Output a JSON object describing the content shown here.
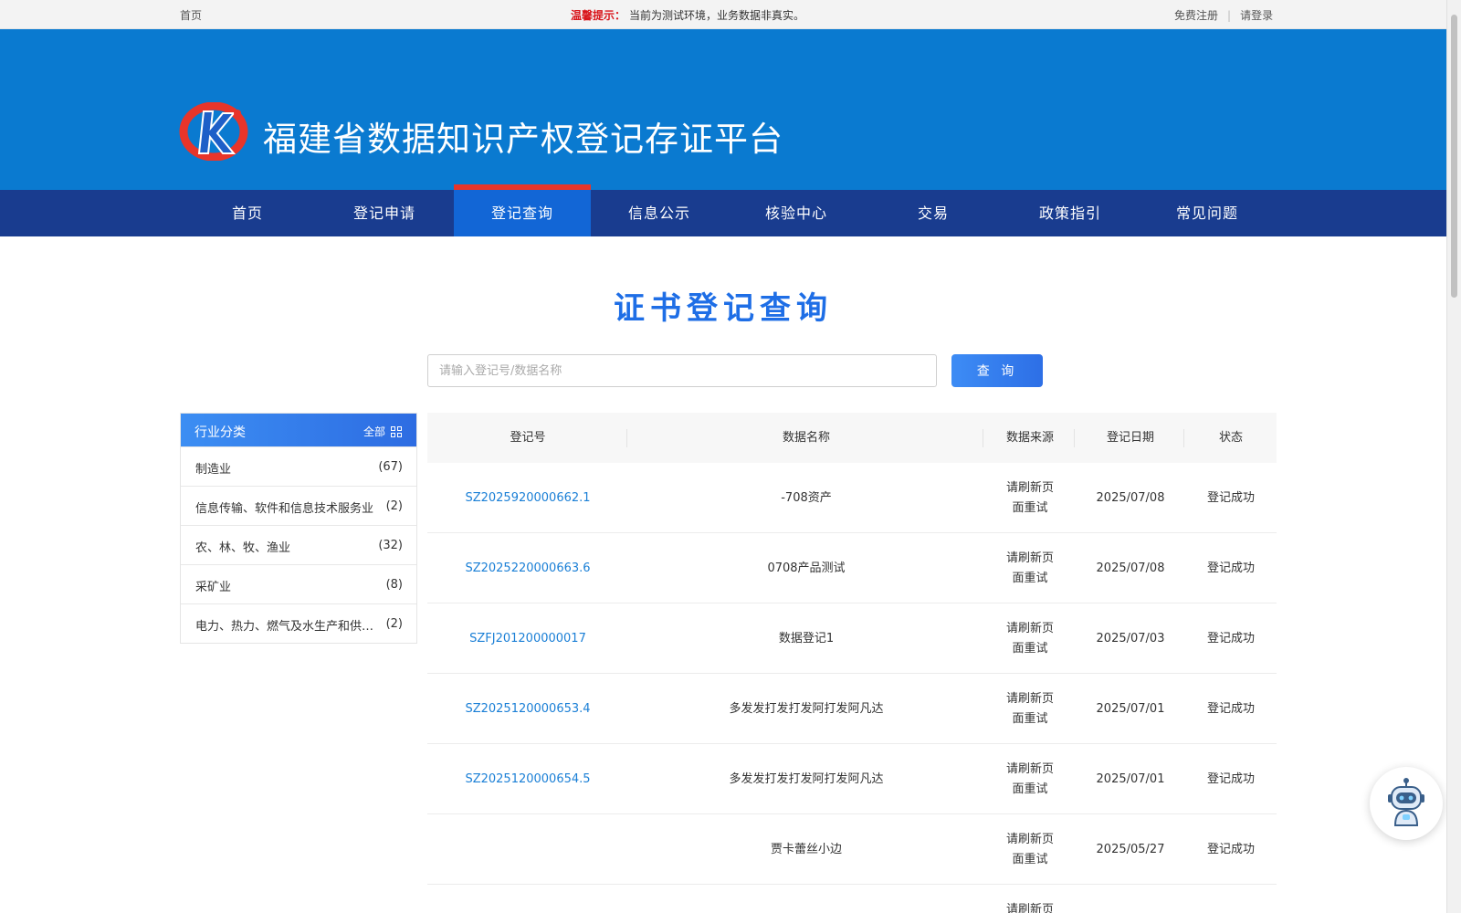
{
  "topbar": {
    "home": "首页",
    "notice_label": "温馨提示：",
    "notice_text": "当前为测试环境，业务数据非真实。",
    "register": "免费注册",
    "login": "请登录"
  },
  "header": {
    "title": "福建省数据知识产权登记存证平台",
    "logo_icon": "k-logo-icon",
    "colors": {
      "banner": "#0a7ad0",
      "nav": "#193c8f",
      "nav_active": "#1266d6",
      "accent": "#e8352a"
    }
  },
  "nav": {
    "items": [
      "首页",
      "登记申请",
      "登记查询",
      "信息公示",
      "核验中心",
      "交易",
      "政策指引",
      "常见问题"
    ],
    "active": "登记查询"
  },
  "main": {
    "title": "证书登记查询",
    "search_placeholder": "请输入登记号/数据名称",
    "search_button": "查 询"
  },
  "sidebar": {
    "title": "行业分类",
    "all_label": "全部",
    "items": [
      {
        "name": "制造业",
        "count": "(67)"
      },
      {
        "name": "信息传输、软件和信息技术服务业",
        "count": "(2)"
      },
      {
        "name": "农、林、牧、渔业",
        "count": "(32)"
      },
      {
        "name": "采矿业",
        "count": "(8)"
      },
      {
        "name": "电力、热力、燃气及水生产和供应业",
        "count": "(2)"
      }
    ]
  },
  "table": {
    "headers": [
      "登记号",
      "数据名称",
      "数据来源",
      "登记日期",
      "状态"
    ],
    "rows": [
      {
        "id": "SZ2025920000662.1",
        "name": "-708资产",
        "source": "请刷新页面重试",
        "date": "2025/07/08",
        "status": "登记成功"
      },
      {
        "id": "SZ2025220000663.6",
        "name": "0708产品测试",
        "source": "请刷新页面重试",
        "date": "2025/07/08",
        "status": "登记成功"
      },
      {
        "id": "SZFJ201200000017",
        "name": "数据登记1",
        "source": "请刷新页面重试",
        "date": "2025/07/03",
        "status": "登记成功"
      },
      {
        "id": "SZ2025120000653.4",
        "name": "多发发打发打发阿打发阿凡达",
        "source": "请刷新页面重试",
        "date": "2025/07/01",
        "status": "登记成功"
      },
      {
        "id": "SZ2025120000654.5",
        "name": "多发发打发打发阿打发阿凡达",
        "source": "请刷新页面重试",
        "date": "2025/07/01",
        "status": "登记成功"
      },
      {
        "id": "",
        "name": "贾卡蕾丝小边",
        "source": "请刷新页面重试",
        "date": "2025/05/27",
        "status": "登记成功"
      },
      {
        "id": "",
        "name": "",
        "source": "请刷新页面重试",
        "date": "",
        "status": ""
      }
    ]
  },
  "assistant": {
    "icon": "robot-assistant-icon"
  }
}
